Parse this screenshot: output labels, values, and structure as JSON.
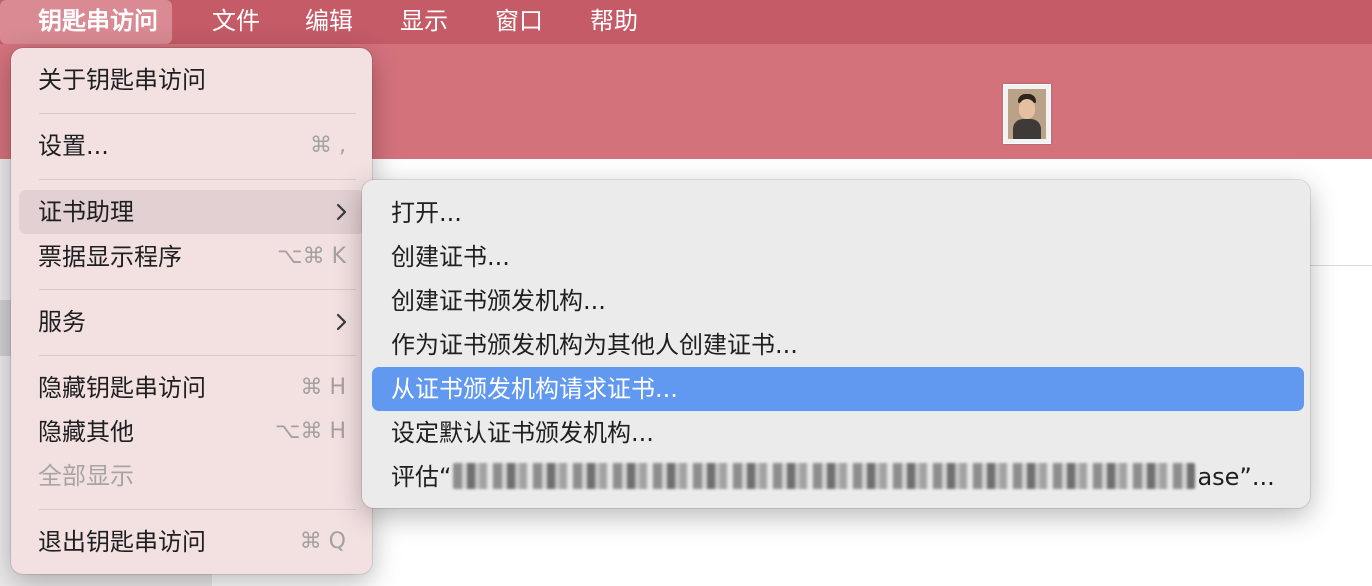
{
  "menubar": {
    "app_name": "钥匙串访问",
    "items": [
      "文件",
      "编辑",
      "显示",
      "窗口",
      "帮助"
    ]
  },
  "main_menu": {
    "about": "关于钥匙串访问",
    "settings": "设置...",
    "settings_shortcut": "⌘ ,",
    "cert_assistant": "证书助理",
    "ticket_viewer": "票据显示程序",
    "ticket_viewer_shortcut": "⌥⌘ K",
    "services": "服务",
    "hide": "隐藏钥匙串访问",
    "hide_shortcut": "⌘ H",
    "hide_others": "隐藏其他",
    "hide_others_shortcut": "⌥⌘ H",
    "show_all": "全部显示",
    "quit": "退出钥匙串访问",
    "quit_shortcut": "⌘ Q"
  },
  "cert_submenu": {
    "open": "打开...",
    "create_cert": "创建证书...",
    "create_ca": "创建证书颁发机构...",
    "create_for_others": "作为证书颁发机构为其他人创建证书...",
    "request_from_ca": "从证书颁发机构请求证书...",
    "set_default_ca": "设定默认证书颁发机构...",
    "evaluate_prefix": "评估“",
    "evaluate_suffix": "ase”..."
  },
  "colors": {
    "menubar": "#c45b66",
    "selection": "#6198f0",
    "toolbar": "#d4727c"
  },
  "icons": {
    "chevron": "chevron-right-icon",
    "avatar": "user-avatar"
  }
}
